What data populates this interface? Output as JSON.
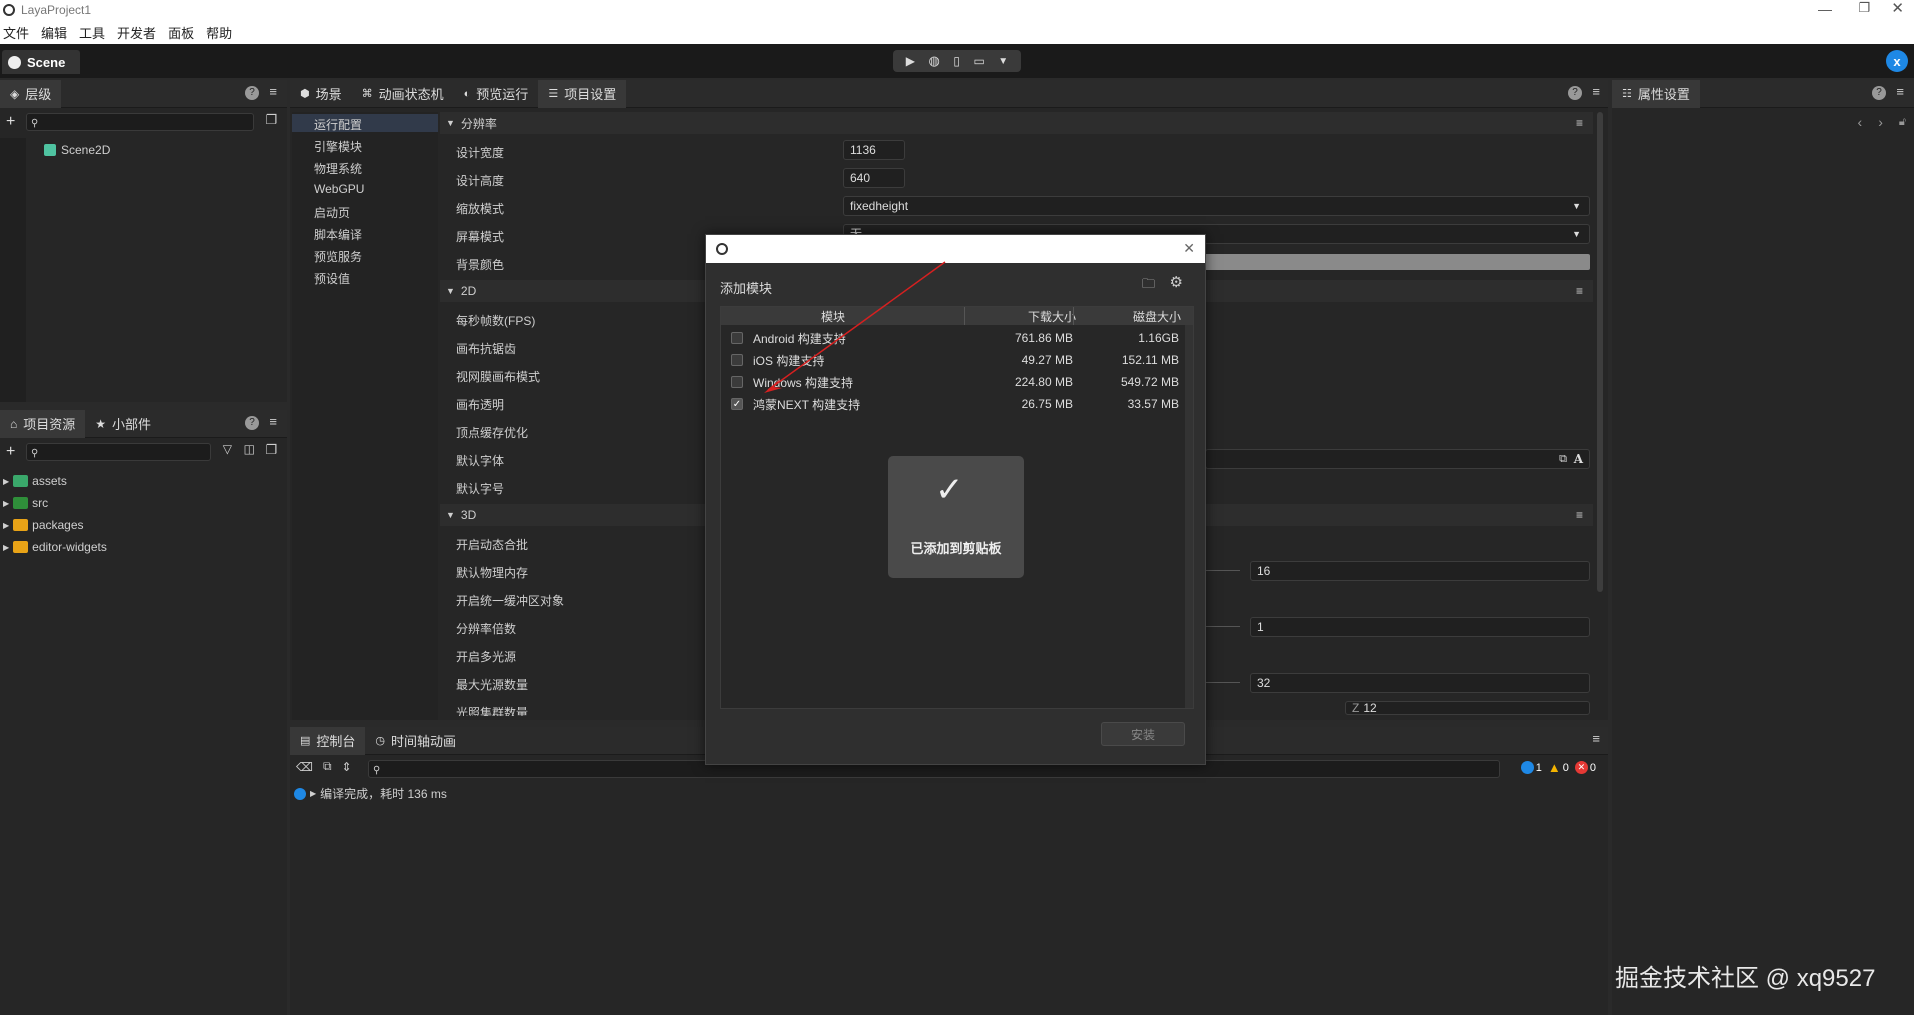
{
  "window": {
    "title": "LayaProject1"
  },
  "menu": [
    "文件",
    "编辑",
    "工具",
    "开发者",
    "面板",
    "帮助"
  ],
  "toolbar": {
    "scene_tab": "Scene",
    "user_initial": "x"
  },
  "hierarchy": {
    "tab": "层级",
    "items": [
      {
        "label": "Scene2D"
      }
    ]
  },
  "center_tabs": [
    "场景",
    "动画状态机",
    "预览运行",
    "项目设置"
  ],
  "properties": {
    "tab": "属性设置"
  },
  "settings_nav": [
    "运行配置",
    "引擎模块",
    "物理系统",
    "WebGPU",
    "启动页",
    "脚本编译",
    "预览服务",
    "预设值"
  ],
  "settings": {
    "section_resolution": "分辨率",
    "design_width_label": "设计宽度",
    "design_width": "1136",
    "design_height_label": "设计高度",
    "design_height": "640",
    "scale_mode_label": "缩放模式",
    "scale_mode": "fixedheight",
    "screen_mode_label": "屏幕模式",
    "screen_mode": "无",
    "bg_color_label": "背景颜色",
    "section_2d": "2D",
    "rows_2d": [
      "每秒帧数(FPS)",
      "画布抗锯齿",
      "视网膜画布模式",
      "画布透明",
      "顶点缓存优化",
      "默认字体",
      "默认字号"
    ],
    "section_3d": "3D",
    "rows_3d": [
      "开启动态合批",
      "默认物理内存",
      "开启统一缓冲区对象",
      "分辨率倍数",
      "开启多光源",
      "最大光源数量",
      "光照集群数量"
    ],
    "val_physics_memory": "16",
    "val_resolution_multiple": "1",
    "val_max_lights": "32",
    "val_cluster_z_label": "Z",
    "val_cluster_z": "12"
  },
  "assets": {
    "tabs": [
      "项目资源",
      "小部件"
    ],
    "items": [
      {
        "label": "assets",
        "color": "#3aa86b"
      },
      {
        "label": "src",
        "color": "#2f8f3a"
      },
      {
        "label": "packages",
        "color": "#e8a317"
      },
      {
        "label": "editor-widgets",
        "color": "#e8a317"
      }
    ]
  },
  "console": {
    "tabs": [
      "控制台",
      "时间轴动画"
    ],
    "message": "编译完成，耗时 136 ms",
    "counts": {
      "info": "1",
      "warn": "0",
      "error": "0"
    }
  },
  "dialog": {
    "title": "添加模块",
    "columns": [
      "模块",
      "下载大小",
      "磁盘大小"
    ],
    "modules": [
      {
        "name": "Android 构建支持",
        "download": "761.86 MB",
        "disk": "1.16GB",
        "checked": false
      },
      {
        "name": "iOS 构建支持",
        "download": "49.27 MB",
        "disk": "152.11 MB",
        "checked": false
      },
      {
        "name": "Windows 构建支持",
        "download": "224.80 MB",
        "disk": "549.72 MB",
        "checked": false
      },
      {
        "name": "鸿蒙NEXT 构建支持",
        "download": "26.75 MB",
        "disk": "33.57 MB",
        "checked": true
      }
    ],
    "toast": "已添加到剪贴板",
    "install_button": "安装"
  },
  "watermark": "掘金技术社区 @ xq9527",
  "colors": {
    "accent": "#1e88e5",
    "arrow": "#d62020",
    "warn": "#f4b400",
    "error": "#e53935"
  }
}
